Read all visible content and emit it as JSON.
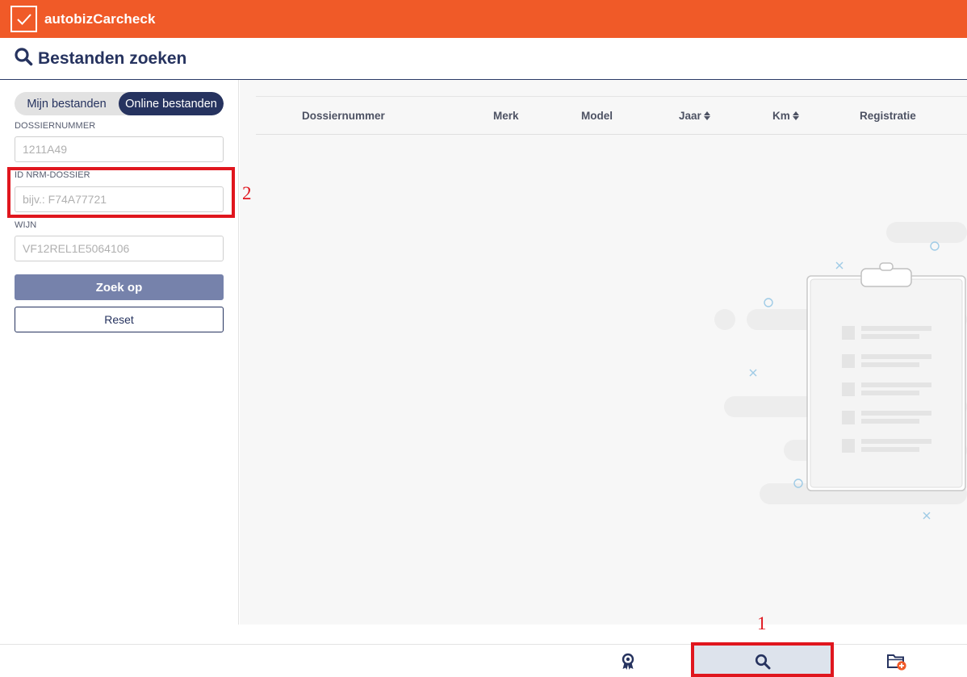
{
  "app": {
    "brand": "autobizCarcheck"
  },
  "page": {
    "title": "Bestanden zoeken"
  },
  "sidebar": {
    "segments": [
      "Mijn bestanden",
      "Online bestanden"
    ],
    "active_segment": "Online bestanden",
    "fields": [
      {
        "label": "DOSSIERNUMMER",
        "placeholder": "1211A49"
      },
      {
        "label": "ID NRM-DOSSIER",
        "placeholder": "bijv.: F74A77721"
      },
      {
        "label": "WIJN",
        "placeholder": "VF12REL1E5064106"
      }
    ],
    "search_label": "Zoek op",
    "reset_label": "Reset"
  },
  "table": {
    "columns": [
      {
        "label": "Dossiernummer",
        "sortable": false
      },
      {
        "label": "Merk",
        "sortable": false
      },
      {
        "label": "Model",
        "sortable": false
      },
      {
        "label": "Jaar",
        "sortable": true
      },
      {
        "label": "Km",
        "sortable": true
      },
      {
        "label": "Registratie",
        "sortable": false
      }
    ],
    "rows": []
  },
  "bottom_nav": {
    "items": [
      {
        "icon": "award-badge-icon",
        "active": false
      },
      {
        "icon": "search-icon",
        "active": true
      },
      {
        "icon": "folder-add-icon",
        "active": false
      }
    ]
  },
  "annotations": [
    "1",
    "2"
  ],
  "colors": {
    "brand": "#f05a28",
    "navy": "#26335f",
    "button": "#7682ab",
    "annotation": "#e0161e"
  }
}
